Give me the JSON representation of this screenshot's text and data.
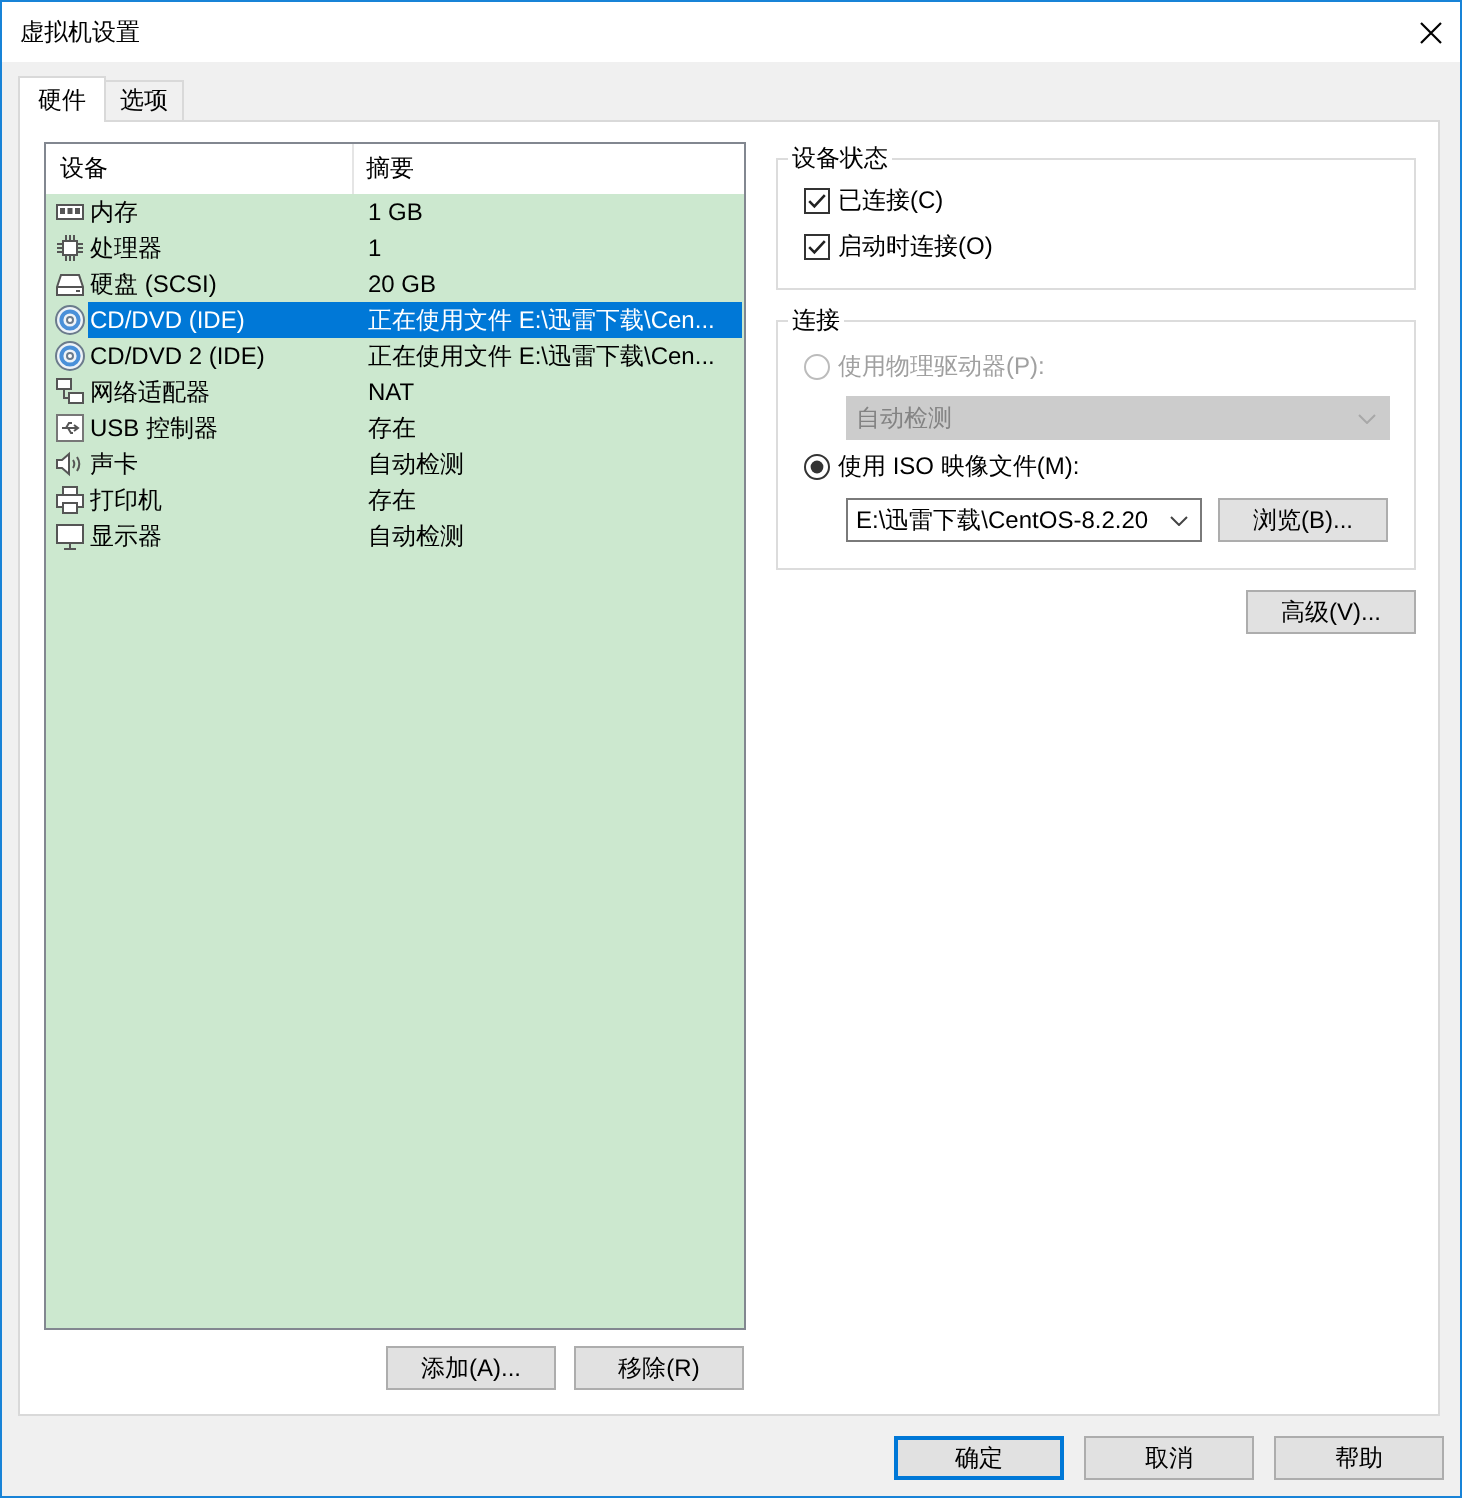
{
  "window": {
    "title": "虚拟机设置"
  },
  "tabs": [
    {
      "label": "硬件",
      "selected": true
    },
    {
      "label": "选项",
      "selected": false
    }
  ],
  "device_list": {
    "columns": [
      "设备",
      "摘要"
    ],
    "devices": [
      {
        "kind": "memory",
        "name": "内存",
        "summary": "1 GB",
        "selected": false
      },
      {
        "kind": "processor",
        "name": "处理器",
        "summary": "1",
        "selected": false
      },
      {
        "kind": "hard_disk",
        "name": "硬盘 (SCSI)",
        "summary": "20 GB",
        "selected": false
      },
      {
        "kind": "cd_dvd",
        "name": "CD/DVD (IDE)",
        "summary": "正在使用文件 E:\\迅雷下载\\Cen...",
        "selected": true
      },
      {
        "kind": "cd_dvd",
        "name": "CD/DVD 2 (IDE)",
        "summary": "正在使用文件 E:\\迅雷下载\\Cen...",
        "selected": false
      },
      {
        "kind": "network",
        "name": "网络适配器",
        "summary": "NAT",
        "selected": false
      },
      {
        "kind": "usb",
        "name": "USB 控制器",
        "summary": "存在",
        "selected": false
      },
      {
        "kind": "sound",
        "name": "声卡",
        "summary": "自动检测",
        "selected": false
      },
      {
        "kind": "printer",
        "name": "打印机",
        "summary": "存在",
        "selected": false
      },
      {
        "kind": "display",
        "name": "显示器",
        "summary": "自动检测",
        "selected": false
      }
    ],
    "buttons": [
      {
        "label": "添加(A)..."
      },
      {
        "label": "移除(R)"
      }
    ]
  },
  "device_status": {
    "title": "设备状态",
    "checkboxes": [
      {
        "label": "已连接(C)",
        "checked": true
      },
      {
        "label": "启动时连接(O)",
        "checked": true
      }
    ]
  },
  "connection": {
    "title": "连接",
    "options": [
      {
        "kind": "physical_drive",
        "label": "使用物理驱动器(P):",
        "selected": false,
        "disabled": true,
        "dropdown": {
          "value": "自动检测",
          "disabled": true
        }
      },
      {
        "kind": "iso_file",
        "label": "使用 ISO 映像文件(M):",
        "selected": true,
        "disabled": false,
        "file_path": {
          "value": "E:\\迅雷下载\\CentOS-8.2.20"
        },
        "browse_button": {
          "label": "浏览(B)..."
        }
      }
    ]
  },
  "advanced_button": {
    "label": "高级(V)..."
  },
  "footer_buttons": [
    {
      "label": "确定",
      "default": true
    },
    {
      "label": "取消",
      "default": false
    },
    {
      "label": "帮助",
      "default": false
    }
  ]
}
